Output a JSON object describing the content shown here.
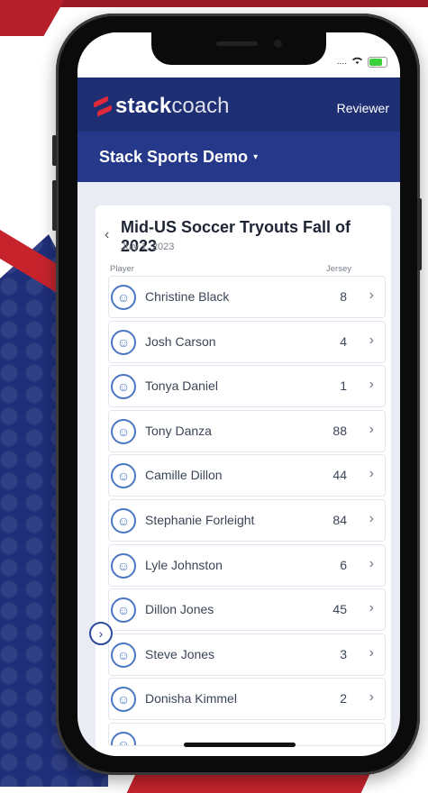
{
  "status": {
    "carrier": "....",
    "battery_label": ""
  },
  "app": {
    "logo_stack": "stack",
    "logo_coach": "coach",
    "reviewer_label": "Reviewer"
  },
  "org": {
    "title": "Stack Sports Demo",
    "caret": "▾"
  },
  "event": {
    "back_icon": "‹",
    "title": "Mid-US Soccer Tryouts Fall of 2023",
    "date": "July 1, 2023"
  },
  "columns": {
    "player": "Player",
    "jersey": "Jersey"
  },
  "players": [
    {
      "name": "Christine Black",
      "jersey": "8"
    },
    {
      "name": "Josh Carson",
      "jersey": "4"
    },
    {
      "name": "Tonya Daniel",
      "jersey": "1"
    },
    {
      "name": "Tony Danza",
      "jersey": "88"
    },
    {
      "name": "Camille Dillon",
      "jersey": "44"
    },
    {
      "name": "Stephanie Forleight",
      "jersey": "84"
    },
    {
      "name": "Lyle Johnston",
      "jersey": "6"
    },
    {
      "name": "Dillon Jones",
      "jersey": "45"
    },
    {
      "name": "Steve Jones",
      "jersey": "3"
    },
    {
      "name": "Donisha Kimmel",
      "jersey": "2"
    }
  ],
  "icons": {
    "row_chevron": "›",
    "avatar": "user-icon",
    "floating": "chevron-right-icon"
  },
  "colors": {
    "appbar": "#1e2f73",
    "orgbar": "#25388a",
    "accent": "#e0293a",
    "avatar": "#4a76c4"
  }
}
